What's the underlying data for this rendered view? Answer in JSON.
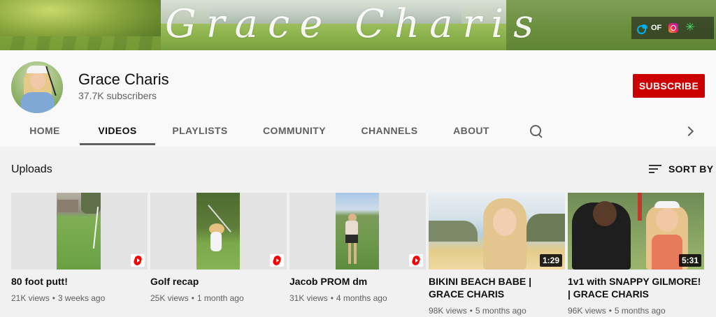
{
  "banner": {
    "title": "Grace Charis",
    "links": [
      {
        "name": "onlyfans",
        "label": "OF",
        "icon": "onlyfans-icon"
      },
      {
        "name": "instagram",
        "label": "",
        "icon": "instagram-icon"
      },
      {
        "name": "linktree",
        "label": "",
        "icon": "linktree-icon"
      }
    ]
  },
  "channel": {
    "name": "Grace Charis",
    "subscribers": "37.7K subscribers",
    "subscribe_label": "SUBSCRIBE",
    "subscribe_color": "#cc0000"
  },
  "tabs": [
    {
      "label": "HOME",
      "active": false
    },
    {
      "label": "VIDEOS",
      "active": true
    },
    {
      "label": "PLAYLISTS",
      "active": false
    },
    {
      "label": "COMMUNITY",
      "active": false
    },
    {
      "label": "CHANNELS",
      "active": false
    },
    {
      "label": "ABOUT",
      "active": false
    }
  ],
  "uploads": {
    "title": "Uploads",
    "sort_label": "SORT BY",
    "videos": [
      {
        "title": "80 foot putt!",
        "views": "21K views",
        "age": "3 weeks ago",
        "type": "short",
        "duration": ""
      },
      {
        "title": "Golf recap",
        "views": "25K views",
        "age": "1 month ago",
        "type": "short",
        "duration": ""
      },
      {
        "title": "Jacob PROM dm",
        "views": "31K views",
        "age": "4 months ago",
        "type": "short",
        "duration": ""
      },
      {
        "title": "BIKINI BEACH BABE | GRACE CHARIS",
        "views": "98K views",
        "age": "5 months ago",
        "type": "video",
        "duration": "1:29"
      },
      {
        "title": "1v1 with SNAPPY GILMORE! | GRACE CHARIS",
        "views": "96K views",
        "age": "5 months ago",
        "type": "video",
        "duration": "5:31"
      }
    ]
  }
}
